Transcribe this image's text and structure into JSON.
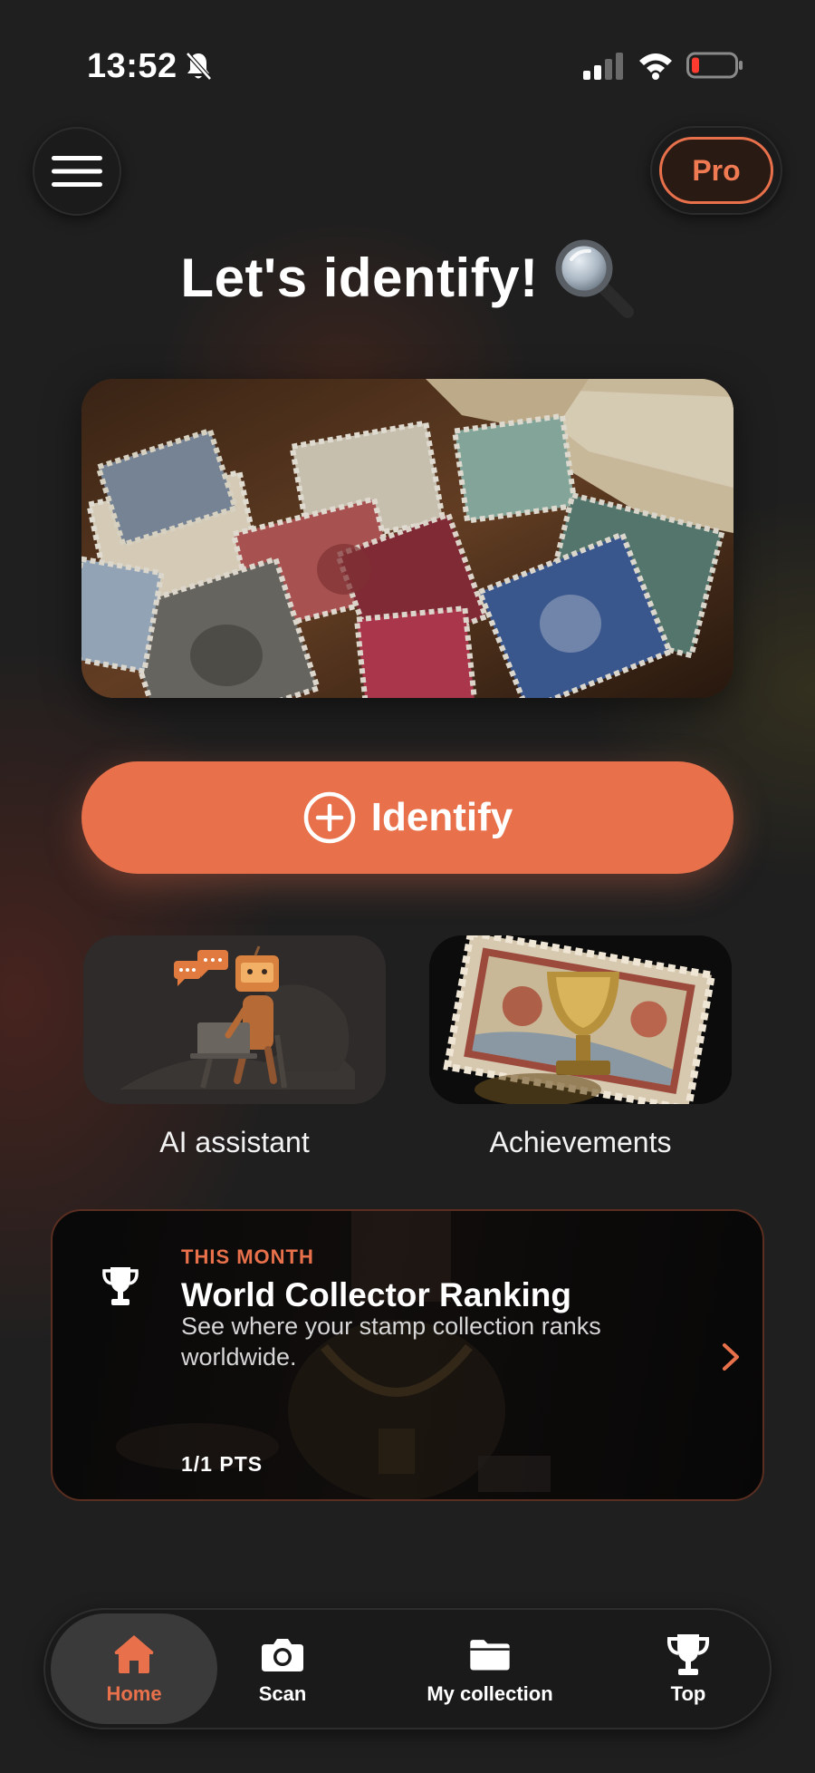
{
  "status_bar": {
    "time": "13:52"
  },
  "header": {
    "pro_label": "Pro"
  },
  "main": {
    "title": "Let's identify!",
    "identify_label": "Identify",
    "features": [
      {
        "label": "AI assistant"
      },
      {
        "label": "Achievements"
      }
    ],
    "ranking": {
      "kicker": "THIS MONTH",
      "title": "World Collector Ranking",
      "description": "See where your stamp collection ranks worldwide.",
      "points": "1/1 PTS"
    }
  },
  "tab_bar": {
    "items": [
      {
        "label": "Home",
        "icon": "home-icon",
        "active": true
      },
      {
        "label": "Scan",
        "icon": "camera-icon",
        "active": false
      },
      {
        "label": "My collection",
        "icon": "folder-icon",
        "active": false
      },
      {
        "label": "Top",
        "icon": "trophy-icon",
        "active": false
      }
    ]
  },
  "colors": {
    "accent": "#e8714c",
    "background": "#1f1f1f",
    "surface": "#1a1a1a"
  }
}
